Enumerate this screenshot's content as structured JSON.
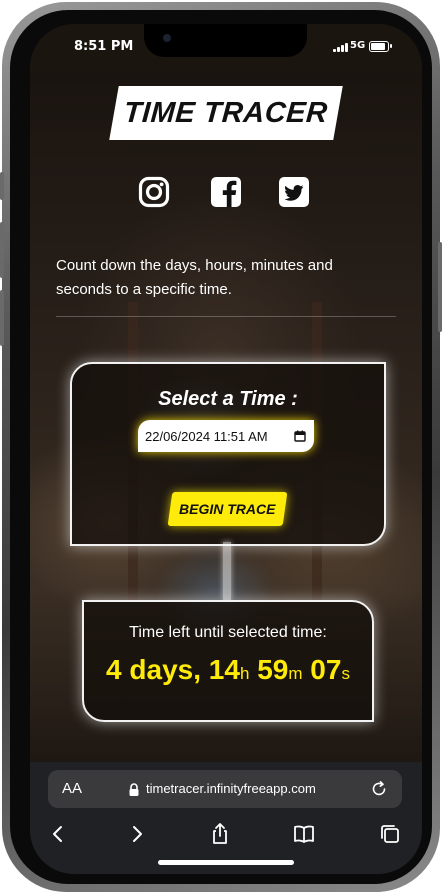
{
  "status_bar": {
    "time": "8:51 PM",
    "network": "5G",
    "icons": [
      "signal-icon",
      "battery-icon"
    ]
  },
  "app": {
    "logo_text": "TIME TRACER",
    "social_icons": [
      "instagram-icon",
      "facebook-icon",
      "twitter-icon"
    ],
    "tagline": "Count down the days, hours, minutes and seconds to a specific time."
  },
  "selector": {
    "label": "Select a Time :",
    "datetime_value": "22/06/2024 11:51 AM",
    "button_label": "BEGIN TRACE"
  },
  "result": {
    "label": "Time left until selected time:",
    "days": "4 days,",
    "hours": "14",
    "hours_unit": "h",
    "minutes": "59",
    "minutes_unit": "m",
    "seconds": "07",
    "seconds_unit": "s"
  },
  "browser": {
    "text_size_label": "AA",
    "url": "timetracer.infinityfreeapp.com",
    "toolbar_icons": [
      "back-icon",
      "forward-icon",
      "share-icon",
      "bookmarks-icon",
      "tabs-icon"
    ]
  },
  "colors": {
    "accent": "#ffeb0a",
    "card_border": "#f2f2f2",
    "text": "#ffffff"
  }
}
